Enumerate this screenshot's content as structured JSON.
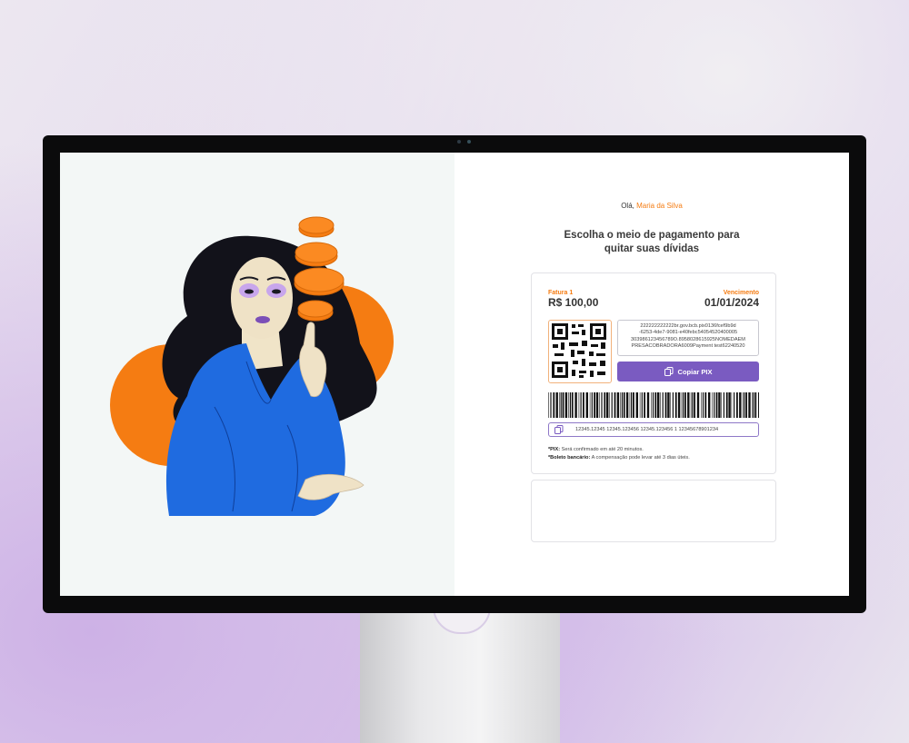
{
  "greeting": {
    "prefix": "Olá,",
    "name": "Maria da Silva"
  },
  "heading": {
    "line1": "Escolha o meio de pagamento para",
    "line2": "quitar suas dívidas"
  },
  "invoice": {
    "label": "Fatura 1",
    "amount": "R$ 100,00",
    "due_label": "Vencimento",
    "due_date": "01/01/2024"
  },
  "pix": {
    "code_line1": "222222222222br.gov.bcb.pix0136fcef9b9d",
    "code_line2": "-6253-4de7-9081-e40febc54054520400005",
    "code_line3": "303986123456789O.8958028615925NOMEDAEM",
    "code_line4": "PRESACOBRADORA6009Payment test62240520",
    "copy_label": "Copiar PIX"
  },
  "boleto": {
    "digitable_line": "12345.12345 12345.123456 12345.123456 1 12345678901234"
  },
  "notes": {
    "pix_label": "*PIX:",
    "pix_text": "Será confirmado em até 20 minutos.",
    "boleto_label": "*Boleto bancário:",
    "boleto_text": "A compensação pode levar até 3 dias úteis."
  },
  "colors": {
    "accent_orange": "#f57c12",
    "button_purple": "#7a5bc1",
    "dress_blue": "#1f6be0"
  },
  "icons": [
    "copy-icon",
    "qr-code-icon",
    "barcode-icon"
  ]
}
